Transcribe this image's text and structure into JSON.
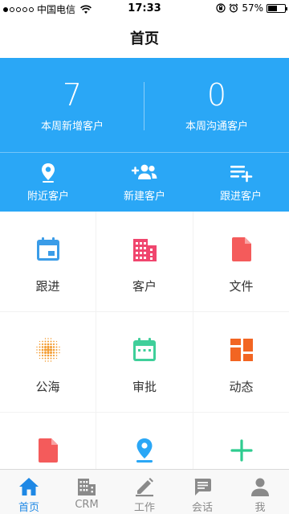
{
  "status_bar": {
    "carrier": "中国电信",
    "time": "17:33",
    "battery": "57%",
    "battery_level": 0.57,
    "signal_bars_filled": 1,
    "signal_bars_total": 5
  },
  "nav": {
    "title": "首页"
  },
  "stats": [
    {
      "value": "7",
      "label": "本周新增客户"
    },
    {
      "value": "0",
      "label": "本周沟通客户"
    }
  ],
  "quick_actions": [
    {
      "label": "附近客户",
      "icon": "location-pin-icon"
    },
    {
      "label": "新建客户",
      "icon": "add-contacts-icon"
    },
    {
      "label": "跟进客户",
      "icon": "add-list-icon"
    }
  ],
  "grid": [
    {
      "label": "跟进",
      "icon": "calendar-icon",
      "color": "#3a9ce8"
    },
    {
      "label": "客户",
      "icon": "building-icon",
      "color": "#f0466e"
    },
    {
      "label": "文件",
      "icon": "file-icon",
      "color": "#f45b5b"
    },
    {
      "label": "公海",
      "icon": "dots-sphere-icon",
      "color": "#f39a2d"
    },
    {
      "label": "审批",
      "icon": "calendar-approval-icon",
      "color": "#3fcf9a"
    },
    {
      "label": "动态",
      "icon": "dashboard-tiles-icon",
      "color": "#f26522"
    },
    {
      "label": "",
      "icon": "file-icon",
      "color": "#f45b5b"
    },
    {
      "label": "",
      "icon": "map-pin-icon",
      "color": "#2aa7f6"
    },
    {
      "label": "",
      "icon": "plus-icon",
      "color": "#2ecc8f"
    }
  ],
  "tabs": [
    {
      "label": "首页",
      "icon": "home-icon",
      "active": true
    },
    {
      "label": "CRM",
      "icon": "building-icon",
      "active": false
    },
    {
      "label": "工作",
      "icon": "pencil-icon",
      "active": false
    },
    {
      "label": "会话",
      "icon": "chat-icon",
      "active": false
    },
    {
      "label": "我",
      "icon": "person-icon",
      "active": false
    }
  ],
  "colors": {
    "brand_blue": "#2aa7f6",
    "tab_active": "#1e88e5",
    "tab_inactive": "#8a8a8a"
  }
}
